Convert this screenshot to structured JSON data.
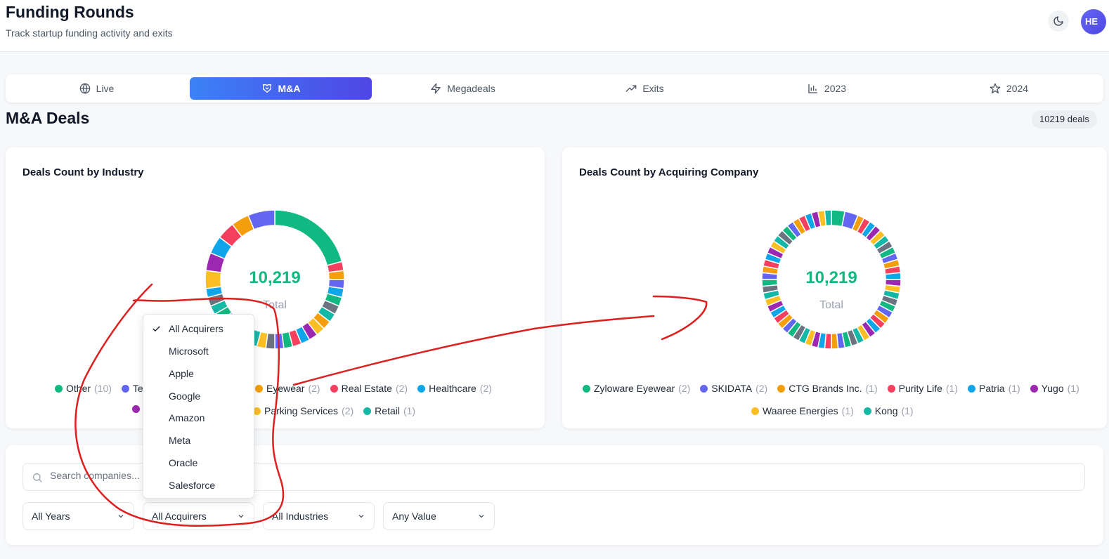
{
  "header": {
    "title": "Funding Rounds",
    "subtitle": "Track startup funding activity and exits",
    "avatar_initials": "HE",
    "theme_icon": "moon-icon"
  },
  "tabs": [
    {
      "label": "Live",
      "icon": "globe-icon",
      "active": false
    },
    {
      "label": "M&A",
      "icon": "handshake-icon",
      "active": true
    },
    {
      "label": "Megadeals",
      "icon": "lightning-icon",
      "active": false
    },
    {
      "label": "Exits",
      "icon": "trending-up-icon",
      "active": false
    },
    {
      "label": "2023",
      "icon": "bar-chart-icon",
      "active": false
    },
    {
      "label": "2024",
      "icon": "star-icon",
      "active": false
    }
  ],
  "section": {
    "title": "M&A Deals",
    "deal_count": "10219 deals"
  },
  "chart_data": [
    {
      "type": "pie",
      "title": "Deals Count by Industry",
      "center_value": "10,219",
      "center_label": "Total",
      "legend": [
        {
          "label": "Other",
          "count": "(10)",
          "color": "#10b981"
        },
        {
          "label": "Te",
          "count": "",
          "color": "#6366f1"
        },
        {
          "label": "Eyewear",
          "count": "(2)",
          "color": "#f59e0b"
        },
        {
          "label": "Real Estate",
          "count": "(2)",
          "color": "#f43f5e"
        },
        {
          "label": "Healthcare",
          "count": "(2)",
          "color": "#0ea5e9"
        },
        {
          "label": "",
          "count": "",
          "color": "#9c27b0"
        },
        {
          "label": "Parking Services",
          "count": "(2)",
          "color": "#fbbf24"
        },
        {
          "label": "Retail",
          "count": "(1)",
          "color": "#14b8a6"
        }
      ],
      "slices": [
        {
          "value": 10,
          "color": "#10b981"
        },
        {
          "value": 1,
          "color": "#f43f5e"
        },
        {
          "value": 1,
          "color": "#f59e0b"
        },
        {
          "value": 1,
          "color": "#6366f1"
        },
        {
          "value": 1,
          "color": "#0ea5e9"
        },
        {
          "value": 1,
          "color": "#10b981"
        },
        {
          "value": 1,
          "color": "#6b7280"
        },
        {
          "value": 1,
          "color": "#14b8a6"
        },
        {
          "value": 1,
          "color": "#f59e0b"
        },
        {
          "value": 1,
          "color": "#fbbf24"
        },
        {
          "value": 1,
          "color": "#9c27b0"
        },
        {
          "value": 1,
          "color": "#0ea5e9"
        },
        {
          "value": 1,
          "color": "#f43f5e"
        },
        {
          "value": 1,
          "color": "#10b981"
        },
        {
          "value": 1,
          "color": "#6366f1"
        },
        {
          "value": 1,
          "color": "#6b7280"
        },
        {
          "value": 1,
          "color": "#fbbf24"
        },
        {
          "value": 1,
          "color": "#14b8a6"
        },
        {
          "value": 1,
          "color": "#f43f5e"
        },
        {
          "value": 1,
          "color": "#f59e0b"
        },
        {
          "value": 1,
          "color": "#9c27b0"
        },
        {
          "value": 1,
          "color": "#6366f1"
        },
        {
          "value": 1,
          "color": "#10b981"
        },
        {
          "value": 1,
          "color": "#14b8a6"
        },
        {
          "value": 1,
          "color": "#6b7280"
        },
        {
          "value": 1,
          "color": "#0ea5e9"
        },
        {
          "value": 2,
          "color": "#fbbf24"
        },
        {
          "value": 2,
          "color": "#9c27b0"
        },
        {
          "value": 2,
          "color": "#0ea5e9"
        },
        {
          "value": 2,
          "color": "#f43f5e"
        },
        {
          "value": 2,
          "color": "#f59e0b"
        },
        {
          "value": 3,
          "color": "#6366f1"
        }
      ]
    },
    {
      "type": "pie",
      "title": "Deals Count by Acquiring Company",
      "center_value": "10,219",
      "center_label": "Total",
      "legend": [
        {
          "label": "Zyloware Eyewear",
          "count": "(2)",
          "color": "#10b981"
        },
        {
          "label": "SKIDATA",
          "count": "(2)",
          "color": "#6366f1"
        },
        {
          "label": "CTG Brands Inc.",
          "count": "(1)",
          "color": "#f59e0b"
        },
        {
          "label": "Purity Life",
          "count": "(1)",
          "color": "#f43f5e"
        },
        {
          "label": "Patria",
          "count": "(1)",
          "color": "#0ea5e9"
        },
        {
          "label": "Yugo",
          "count": "(1)",
          "color": "#9c27b0"
        },
        {
          "label": "Waaree Energies",
          "count": "(1)",
          "color": "#fbbf24"
        },
        {
          "label": "Kong",
          "count": "(1)",
          "color": "#14b8a6"
        }
      ],
      "slices": [
        {
          "value": 2,
          "color": "#10b981"
        },
        {
          "value": 2,
          "color": "#6366f1"
        },
        {
          "value": 1,
          "color": "#f59e0b"
        },
        {
          "value": 1,
          "color": "#f43f5e"
        },
        {
          "value": 1,
          "color": "#0ea5e9"
        },
        {
          "value": 1,
          "color": "#9c27b0"
        },
        {
          "value": 1,
          "color": "#fbbf24"
        },
        {
          "value": 1,
          "color": "#14b8a6"
        },
        {
          "value": 1,
          "color": "#6b7280"
        },
        {
          "value": 1,
          "color": "#10b981"
        },
        {
          "value": 1,
          "color": "#6366f1"
        },
        {
          "value": 1,
          "color": "#f59e0b"
        },
        {
          "value": 1,
          "color": "#f43f5e"
        },
        {
          "value": 1,
          "color": "#0ea5e9"
        },
        {
          "value": 1,
          "color": "#9c27b0"
        },
        {
          "value": 1,
          "color": "#fbbf24"
        },
        {
          "value": 1,
          "color": "#14b8a6"
        },
        {
          "value": 1,
          "color": "#6b7280"
        },
        {
          "value": 1,
          "color": "#10b981"
        },
        {
          "value": 1,
          "color": "#6366f1"
        },
        {
          "value": 1,
          "color": "#f59e0b"
        },
        {
          "value": 1,
          "color": "#f43f5e"
        },
        {
          "value": 1,
          "color": "#0ea5e9"
        },
        {
          "value": 1,
          "color": "#9c27b0"
        },
        {
          "value": 1,
          "color": "#fbbf24"
        },
        {
          "value": 1,
          "color": "#14b8a6"
        },
        {
          "value": 1,
          "color": "#6b7280"
        },
        {
          "value": 1,
          "color": "#10b981"
        },
        {
          "value": 1,
          "color": "#6366f1"
        },
        {
          "value": 1,
          "color": "#f59e0b"
        },
        {
          "value": 1,
          "color": "#f43f5e"
        },
        {
          "value": 1,
          "color": "#0ea5e9"
        },
        {
          "value": 1,
          "color": "#9c27b0"
        },
        {
          "value": 1,
          "color": "#fbbf24"
        },
        {
          "value": 1,
          "color": "#14b8a6"
        },
        {
          "value": 1,
          "color": "#6b7280"
        },
        {
          "value": 1,
          "color": "#10b981"
        },
        {
          "value": 1,
          "color": "#6366f1"
        },
        {
          "value": 1,
          "color": "#f59e0b"
        },
        {
          "value": 1,
          "color": "#f43f5e"
        },
        {
          "value": 1,
          "color": "#0ea5e9"
        },
        {
          "value": 1,
          "color": "#9c27b0"
        },
        {
          "value": 1,
          "color": "#fbbf24"
        },
        {
          "value": 1,
          "color": "#14b8a6"
        },
        {
          "value": 1,
          "color": "#6b7280"
        },
        {
          "value": 1,
          "color": "#10b981"
        },
        {
          "value": 1,
          "color": "#6366f1"
        },
        {
          "value": 1,
          "color": "#f59e0b"
        },
        {
          "value": 1,
          "color": "#f43f5e"
        },
        {
          "value": 1,
          "color": "#0ea5e9"
        },
        {
          "value": 1,
          "color": "#9c27b0"
        },
        {
          "value": 1,
          "color": "#fbbf24"
        },
        {
          "value": 1,
          "color": "#14b8a6"
        },
        {
          "value": 1,
          "color": "#6b7280"
        },
        {
          "value": 1,
          "color": "#10b981"
        },
        {
          "value": 1,
          "color": "#6366f1"
        },
        {
          "value": 1,
          "color": "#f59e0b"
        },
        {
          "value": 1,
          "color": "#f43f5e"
        },
        {
          "value": 1,
          "color": "#0ea5e9"
        },
        {
          "value": 1,
          "color": "#9c27b0"
        },
        {
          "value": 1,
          "color": "#fbbf24"
        },
        {
          "value": 1,
          "color": "#14b8a6"
        }
      ]
    }
  ],
  "filters": {
    "search_placeholder": "Search companies...",
    "years": "All Years",
    "acquirers": "All Acquirers",
    "industries": "All Industries",
    "value": "Any Value"
  },
  "dropdown": {
    "options": [
      "All Acquirers",
      "Microsoft",
      "Apple",
      "Google",
      "Amazon",
      "Meta",
      "Oracle",
      "Salesforce"
    ],
    "selected": "All Acquirers"
  },
  "annotation_color": "#dd1f1f"
}
